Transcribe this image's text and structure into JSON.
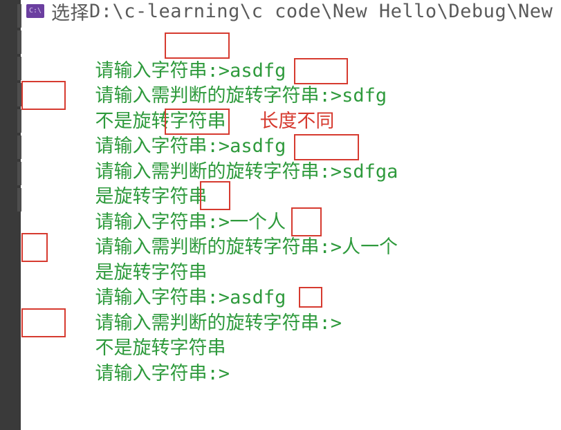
{
  "titlebar": {
    "prefix": "选择",
    "path": "D:\\c-learning\\c code\\New Hello\\Debug\\New"
  },
  "lines": {
    "l1_prompt": "请输入字符串:>",
    "l1_input": "asdfg",
    "l2_prompt": "请输入需判断的旋转字符串:>",
    "l2_input": "sdfg",
    "l3_result": "不是旋转字符串",
    "l3_note": "长度不同",
    "l4_prompt": "请输入字符串:>",
    "l4_input": "asdfg",
    "l5_prompt": "请输入需判断的旋转字符串:>",
    "l5_input": "sdfga",
    "l6_result": "是旋转字符串",
    "l7_prompt": "请输入字符串:>",
    "l7_input_a": "一个",
    "l7_input_b": "人",
    "l8_prompt": "请输入需判断的旋转字符串:>",
    "l8_input_a": "人",
    "l8_input_b": "一个",
    "l9_result": "是旋转字符串",
    "l10_prompt": "请输入字符串:>",
    "l10_input": "asdfg",
    "l11_prompt": "请输入需判断的旋转字符串:>",
    "l11_input": " ",
    "l12_result": "不是旋转字符串",
    "l13_prompt": "请输入字符串:>"
  }
}
